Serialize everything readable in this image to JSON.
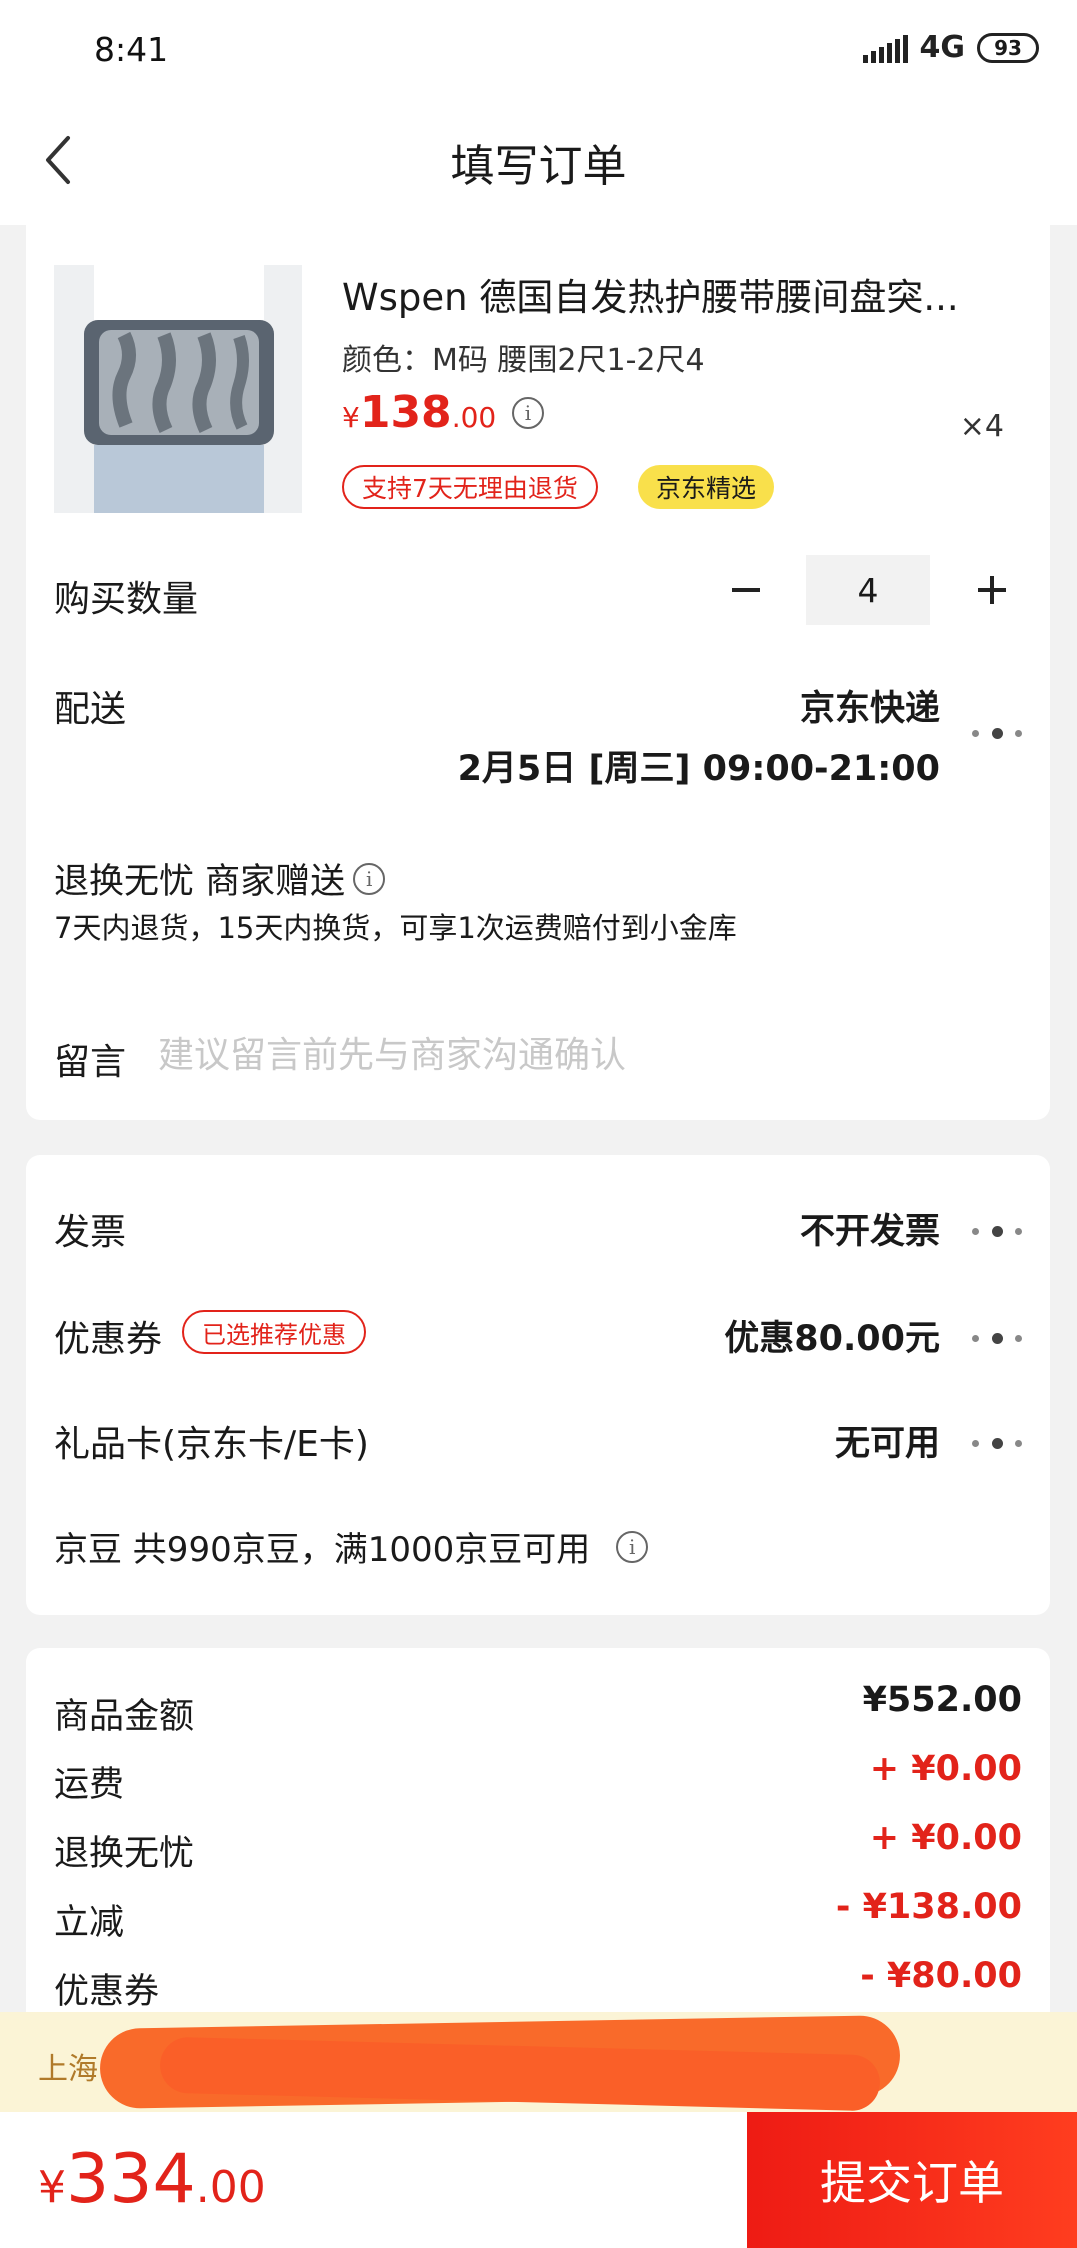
{
  "status_bar": {
    "time": "8:41",
    "network": "4G",
    "battery": "93"
  },
  "nav": {
    "title": "填写订单"
  },
  "product": {
    "title": "Wspen 德国自发热护腰带腰间盘突...",
    "spec": "颜色：M码 腰围2尺1-2尺4",
    "price_symbol": "¥",
    "price_int": "138",
    "price_dec": ".00",
    "quantity_text": "×4",
    "tags": [
      "支持7天无理由退货",
      "京东精选"
    ]
  },
  "quantity": {
    "label": "购买数量",
    "value": "4"
  },
  "delivery": {
    "label": "配送",
    "method": "京东快递",
    "time": "2月5日 [周三] 09:00-21:00"
  },
  "worry_free": {
    "title": "退换无忧 商家赠送",
    "desc": "7天内退货，15天内换货，可享1次运费赔付到小金库"
  },
  "note": {
    "label": "留言",
    "placeholder": "建议留言前先与商家沟通确认"
  },
  "invoice": {
    "label": "发票",
    "value": "不开发票"
  },
  "coupon": {
    "label": "优惠券",
    "tag": "已选推荐优惠",
    "value": "优惠80.00元"
  },
  "gift_card": {
    "label": "礼品卡(京东卡/E卡)",
    "value": "无可用"
  },
  "jd_beans": {
    "text": "京豆 共990京豆，满1000京豆可用"
  },
  "summary": [
    {
      "label": "商品金额",
      "value": "¥552.00",
      "color": "#1a1a1a"
    },
    {
      "label": "运费",
      "value": "+ ¥0.00",
      "color": "#e2231a"
    },
    {
      "label": "退换无忧",
      "value": "+ ¥0.00",
      "color": "#e2231a"
    },
    {
      "label": "立减",
      "value": "- ¥138.00",
      "color": "#e2231a"
    },
    {
      "label": "优惠券",
      "value": "- ¥80.00",
      "color": "#e2231a"
    }
  ],
  "promo": {
    "text": "上海"
  },
  "footer": {
    "total_symbol": "¥",
    "total_int": "334",
    "total_dec": ".00",
    "submit_label": "提交订单"
  },
  "colors": {
    "accent": "#e2231a",
    "jd_tag": "#f9e04b"
  }
}
